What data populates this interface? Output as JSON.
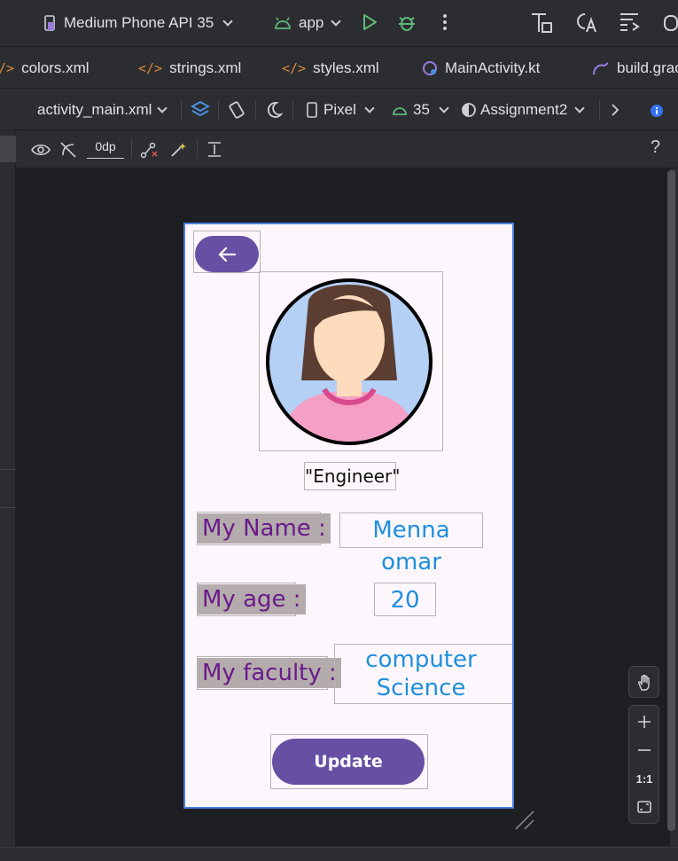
{
  "toolbar": {
    "device": "Medium Phone API 35",
    "run_config": "app"
  },
  "tabs": [
    {
      "label": "colors.xml"
    },
    {
      "label": "strings.xml"
    },
    {
      "label": "styles.xml"
    },
    {
      "label": "MainActivity.kt"
    },
    {
      "label": "build.grad"
    }
  ],
  "design_toolbar": {
    "layout_file": "activity_main.xml",
    "device": "Pixel",
    "api_level": "35",
    "theme": "Assignment2"
  },
  "view_toolbar": {
    "margin": "0dp",
    "help": "?"
  },
  "app_screen": {
    "title": "\"Engineer\"",
    "rows": [
      {
        "label": "My Name :",
        "value": "Menna omar"
      },
      {
        "label": "My age :",
        "value": "20"
      },
      {
        "label": "My faculty :",
        "value": "computer\nScience"
      }
    ],
    "update_button": "Update"
  },
  "zoom_panel": {
    "reset_label": "1:1"
  },
  "colors": {
    "primary": "#6750a4",
    "label_text": "#6a1b8a",
    "value_text": "#1f8fdc",
    "label_bg": "#b4acac",
    "screen_bg": "#fdf7fd"
  }
}
